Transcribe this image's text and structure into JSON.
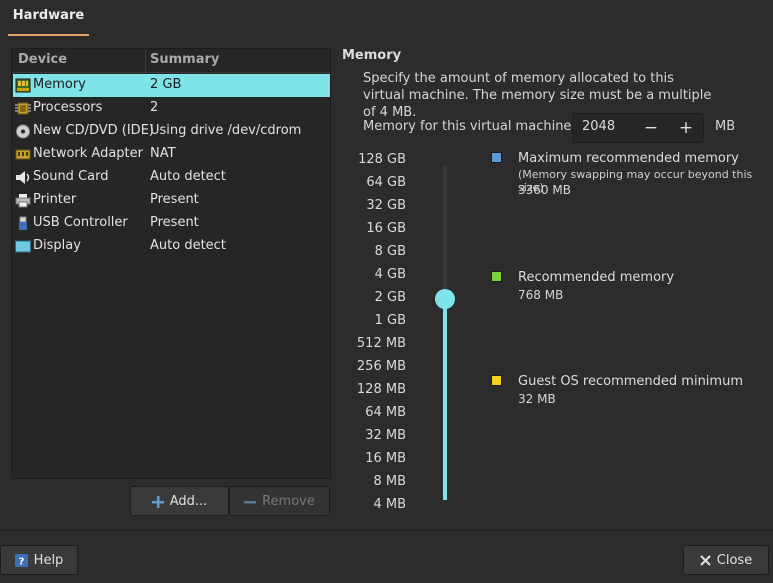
{
  "tabs": [
    {
      "label": "Hardware"
    }
  ],
  "device_table": {
    "headers": {
      "device": "Device",
      "summary": "Summary"
    },
    "rows": [
      {
        "device": "Memory",
        "summary": "2 GB",
        "icon": "memory-chip-icon",
        "selected": true
      },
      {
        "device": "Processors",
        "summary": "2",
        "icon": "processor-icon"
      },
      {
        "device": "New CD/DVD (IDE)",
        "summary": "Using drive /dev/cdrom",
        "icon": "cd-dvd-icon"
      },
      {
        "device": "Network Adapter",
        "summary": "NAT",
        "icon": "network-adapter-icon"
      },
      {
        "device": "Sound Card",
        "summary": "Auto detect",
        "icon": "speaker-icon"
      },
      {
        "device": "Printer",
        "summary": "Present",
        "icon": "printer-icon"
      },
      {
        "device": "USB Controller",
        "summary": "Present",
        "icon": "usb-icon"
      },
      {
        "device": "Display",
        "summary": "Auto detect",
        "icon": "display-icon"
      }
    ]
  },
  "buttons": {
    "add": "Add...",
    "remove": "Remove",
    "help": "Help",
    "close": "Close"
  },
  "memory": {
    "title": "Memory",
    "description": "Specify the amount of memory allocated to this virtual machine. The memory size must be a multiple of 4 MB.",
    "field_label": "Memory for this virtual machine:",
    "value": "2048",
    "unit": "MB",
    "scale_labels": [
      "128 GB",
      "64 GB",
      "32 GB",
      "16 GB",
      "8 GB",
      "4 GB",
      "2 GB",
      "1 GB",
      "512 MB",
      "256 MB",
      "128 MB",
      "64 MB",
      "32 MB",
      "16 MB",
      "8 MB",
      "4 MB"
    ],
    "slider_selected": "2 GB",
    "legend": {
      "max": {
        "title": "Maximum recommended memory",
        "note": "(Memory swapping may occur beyond this size)",
        "value": "3360 MB",
        "color": "#5b9bd5"
      },
      "recommended": {
        "title": "Recommended memory",
        "value": "768 MB",
        "color": "#7bd33a"
      },
      "minimum": {
        "title": "Guest OS recommended minimum",
        "value": "32 MB",
        "color": "#f0d11b"
      }
    }
  },
  "colors": {
    "accent": "#7fe3ea",
    "tab_underline": "#e4a26b"
  }
}
